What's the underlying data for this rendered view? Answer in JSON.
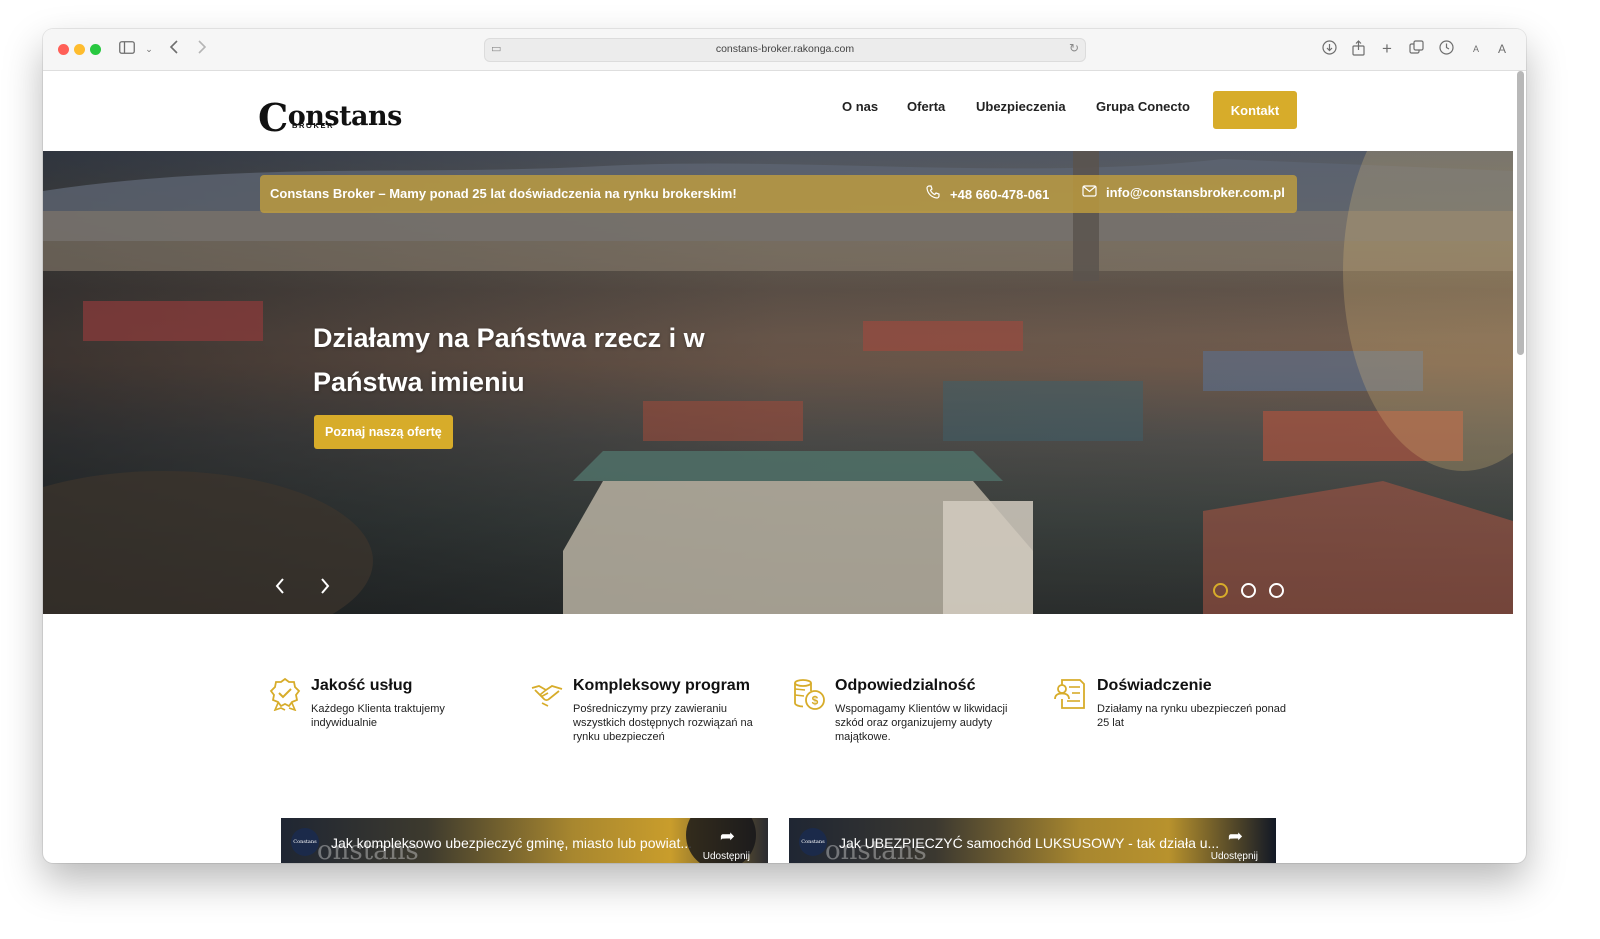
{
  "browser": {
    "url": "constans-broker.rakonga.com",
    "reader_small_label": "A",
    "reader_large_label": "A"
  },
  "site": {
    "logo_text": "onstans",
    "logo_initial": "C",
    "logo_sub": "BROKER",
    "nav": {
      "about": "O nas",
      "offer": "Oferta",
      "insurance": "Ubezpieczenia",
      "group": "Grupa Conecto",
      "contact": "Kontakt"
    }
  },
  "hero": {
    "info_text": "Constans Broker – Mamy ponad 25 lat doświadczenia na rynku brokerskim!",
    "phone": "+48 660-478-061",
    "email": "info@constansbroker.com.pl",
    "title": "Działamy na Państwa rzecz i w Państwa imieniu",
    "cta": "Poznaj naszą ofertę",
    "active_slide": 1,
    "slide_count": 3
  },
  "features": [
    {
      "icon": "quality-badge-icon",
      "title": "Jakość usług",
      "desc": "Każdego Klienta traktujemy indywidualnie"
    },
    {
      "icon": "handshake-icon",
      "title": "Kompleksowy program",
      "desc": "Pośredniczymy przy zawieraniu wszystkich dostępnych rozwiązań na rynku ubezpieczeń"
    },
    {
      "icon": "coins-icon",
      "title": "Odpowiedzialność",
      "desc": "Wspomagamy Klientów w likwidacji szkód oraz organizujemy audyty majątkowe."
    },
    {
      "icon": "document-user-icon",
      "title": "Doświadczenie",
      "desc": "Działamy na rynku ubezpieczeń ponad 25 lat"
    }
  ],
  "videos": [
    {
      "title": "Jak kompleksowo ubezpieczyć gminę, miasto lub powiat...",
      "share": "Udostępnij",
      "channel": "Constans",
      "bg_logo": "onstans"
    },
    {
      "title": "Jak UBEZPIECZYĆ samochód LUKSUSOWY - tak działa u...",
      "share": "Udostępnij",
      "channel": "Constans",
      "bg_logo": "onstans"
    }
  ],
  "colors": {
    "accent": "#d7ac2a",
    "text": "#111111"
  }
}
